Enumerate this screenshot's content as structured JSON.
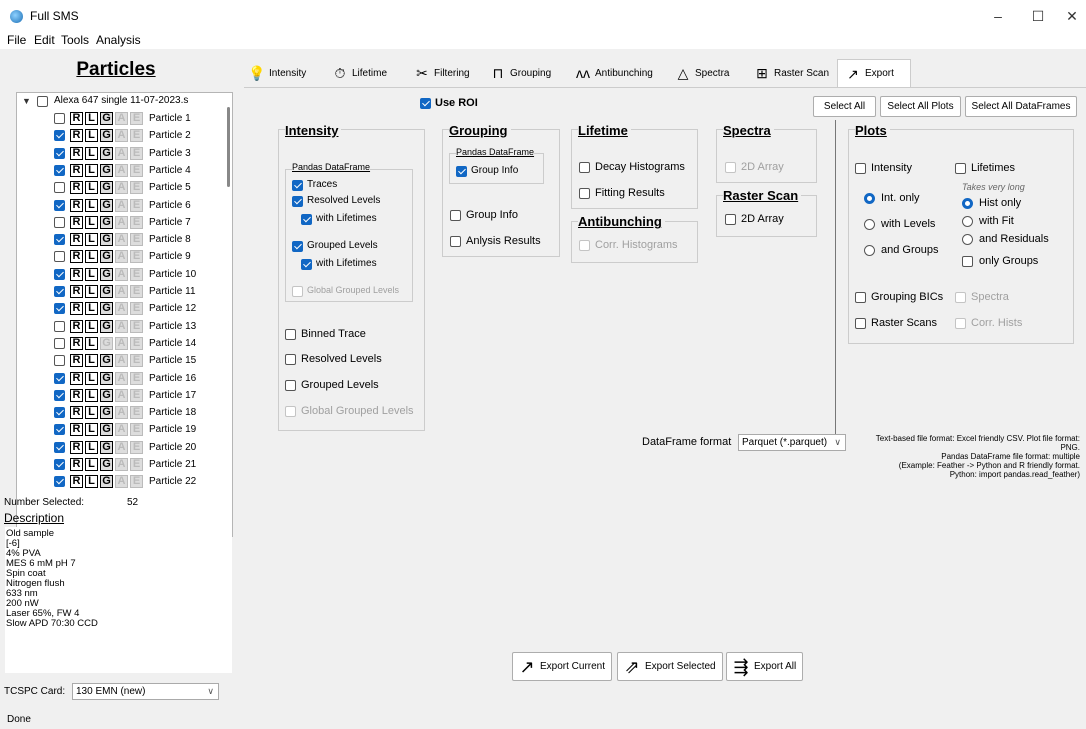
{
  "window": {
    "title": "Full SMS",
    "controls": [
      "–",
      "☐",
      "✕"
    ]
  },
  "menu": [
    "File",
    "Edit",
    "Tools",
    "Analysis"
  ],
  "left": {
    "title": "Particles",
    "root_label": "Alexa 647 single 11-07-2023.s",
    "tag_letters": [
      "R",
      "L",
      "G",
      "A",
      "E"
    ],
    "particles": [
      {
        "label": "Particle 1",
        "checked": false
      },
      {
        "label": "Particle 2",
        "checked": true
      },
      {
        "label": "Particle 3",
        "checked": true
      },
      {
        "label": "Particle 4",
        "checked": true
      },
      {
        "label": "Particle 5",
        "checked": false
      },
      {
        "label": "Particle 6",
        "checked": true
      },
      {
        "label": "Particle 7",
        "checked": false
      },
      {
        "label": "Particle 8",
        "checked": true
      },
      {
        "label": "Particle 9",
        "checked": false
      },
      {
        "label": "Particle 10",
        "checked": true
      },
      {
        "label": "Particle 11",
        "checked": true
      },
      {
        "label": "Particle 12",
        "checked": true
      },
      {
        "label": "Particle 13",
        "checked": false
      },
      {
        "label": "Particle 14",
        "checked": false
      },
      {
        "label": "Particle 15",
        "checked": false
      },
      {
        "label": "Particle 16",
        "checked": true
      },
      {
        "label": "Particle 17",
        "checked": true
      },
      {
        "label": "Particle 18",
        "checked": true
      },
      {
        "label": "Particle 19",
        "checked": true
      },
      {
        "label": "Particle 20",
        "checked": true
      },
      {
        "label": "Particle 21",
        "checked": true
      },
      {
        "label": "Particle 22",
        "checked": true
      }
    ],
    "number_selected_label": "Number Selected:",
    "number_selected_value": "52",
    "description_label": "Description",
    "description_lines": [
      "Old sample",
      "[-6]",
      "4% PVA",
      "MES 6 mM pH 7",
      "Spin coat",
      "Nitrogen flush",
      "633 nm",
      "200 nW",
      "Laser 65%, FW 4",
      "Slow APD 70:30 CCD"
    ],
    "tcspc_label": "TCSPC Card:",
    "tcspc_value": "130 EMN (new)"
  },
  "tabs": [
    {
      "label": "Intensity",
      "icon": "bulb-icon",
      "glyph": "💡"
    },
    {
      "label": "Lifetime",
      "icon": "stopwatch-icon",
      "glyph": "⏱"
    },
    {
      "label": "Filtering",
      "icon": "filter-icon",
      "glyph": "✂"
    },
    {
      "label": "Grouping",
      "icon": "grouping-icon",
      "glyph": "⊓"
    },
    {
      "label": "Antibunching",
      "icon": "antibunching-icon",
      "glyph": "ʌʌ"
    },
    {
      "label": "Spectra",
      "icon": "prism-icon",
      "glyph": "△"
    },
    {
      "label": "Raster Scan",
      "icon": "raster-icon",
      "glyph": "⊞"
    },
    {
      "label": "Export",
      "icon": "export-icon",
      "glyph": "↗"
    }
  ],
  "export": {
    "use_roi": "Use ROI",
    "select_all": "Select All",
    "select_all_plots": "Select All Plots",
    "select_all_dataframes": "Select All DataFrames",
    "intensity": {
      "title": "Intensity",
      "df_title": "Pandas DataFrame",
      "traces": "Traces",
      "resolved_levels": "Resolved Levels",
      "with_lifetimes": "with Lifetimes",
      "grouped_levels": "Grouped Levels",
      "with_lifetimes2": "with Lifetimes",
      "global_grouped": "Global Grouped Levels",
      "binned_trace": "Binned Trace",
      "resolved_levels2": "Resolved Levels",
      "grouped_levels2": "Grouped Levels",
      "global_grouped2": "Global Grouped Levels"
    },
    "grouping": {
      "title": "Grouping",
      "df_title": "Pandas DataFrame",
      "group_info_df": "Group Info",
      "group_info": "Group Info",
      "analysis_results": "Anlysis Results"
    },
    "lifetime": {
      "title": "Lifetime",
      "decay": "Decay Histograms",
      "fitting": "Fitting Results"
    },
    "antibunching": {
      "title": "Antibunching",
      "corr": "Corr. Histograms"
    },
    "spectra": {
      "title": "Spectra",
      "array": "2D Array"
    },
    "raster": {
      "title": "Raster Scan",
      "array": "2D Array"
    },
    "plots": {
      "title": "Plots",
      "intensity": "Intensity",
      "lifetimes": "Lifetimes",
      "takes_long": "Takes very long",
      "int_only": "Int. only",
      "with_levels": "with Levels",
      "and_groups": "and Groups",
      "hist_only": "Hist only",
      "with_fit": "with Fit",
      "and_residuals": "and Residuals",
      "only_groups": "only Groups",
      "grouping_bics": "Grouping BICs",
      "spectra": "Spectra",
      "raster_scans": "Raster Scans",
      "corr_hists": "Corr. Hists"
    },
    "df_format_label": "DataFrame format",
    "df_format_value": "Parquet (*.parquet)",
    "hint_text": "Text-based file format: Excel friendly CSV. Plot file format:\nPNG.\nPandas DataFrame file format: multiple\n(Example: Feather -> Python and R friendly format.\nPython: import pandas.read_feather)",
    "export_current": "Export Current",
    "export_selected": "Export Selected",
    "export_all": "Export All"
  },
  "status": "Done",
  "colors": {
    "accent": "#1167c4"
  }
}
